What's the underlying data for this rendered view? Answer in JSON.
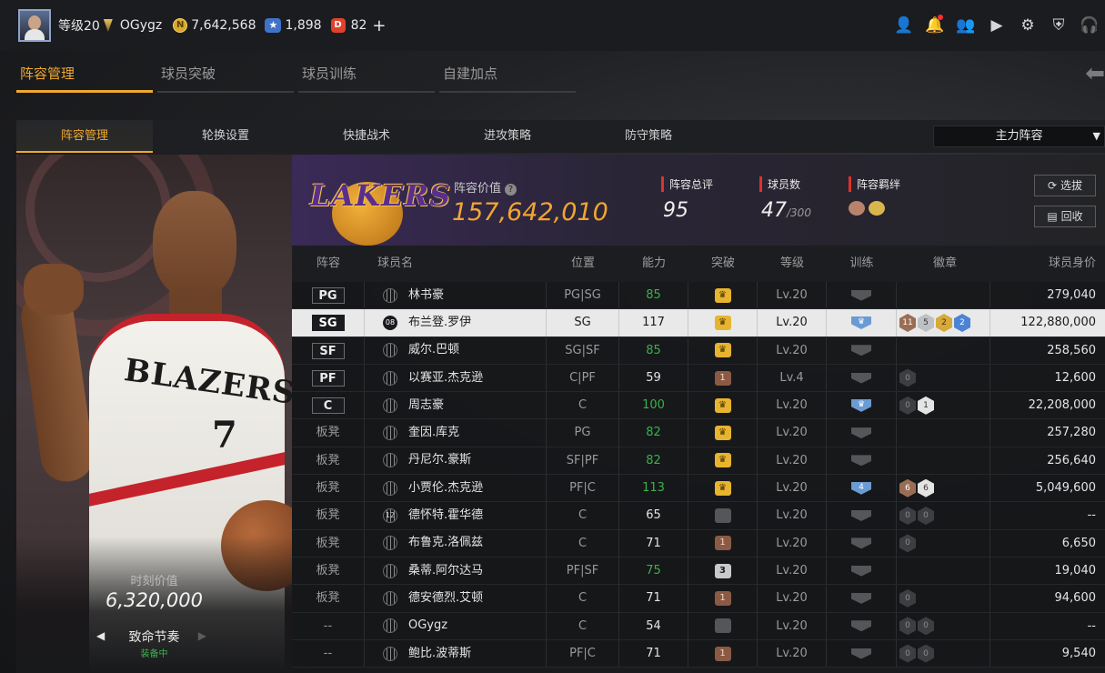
{
  "topbar": {
    "level": "等级20",
    "username": "OGygz",
    "coins": "7,642,568",
    "coin_icon": "N",
    "stars": "1,898",
    "star_icon": "★",
    "diamonds": "82",
    "diamond_icon": "D",
    "plus": "+",
    "icons": [
      "profile-icon",
      "bell-icon",
      "friends-icon",
      "video-icon",
      "gear-icon",
      "shield-icon",
      "headset-icon"
    ]
  },
  "main_tabs": [
    "阵容管理",
    "球员突破",
    "球员训练",
    "自建加点"
  ],
  "sub_tabs": [
    "阵容管理",
    "轮换设置",
    "快捷战术",
    "进攻策略",
    "防守策略"
  ],
  "lineup_select": "主力阵容",
  "player_card": {
    "jersey_text": "BLAZERS",
    "jersey_number": "7",
    "value_label": "时刻价值",
    "value": "6,320,000",
    "skill_name": "致命节奏",
    "skill_state": "装备中"
  },
  "team": {
    "logo_text": "LAKERS",
    "value_label": "阵容价值",
    "value": "157,642,010",
    "rating_label": "阵容总评",
    "rating": "95",
    "players_label": "球员数",
    "players_count": "47",
    "players_max": "/300",
    "bond_label": "阵容羁绊",
    "btn_select": "选拔",
    "btn_recycle": "回收"
  },
  "table": {
    "headers": [
      "阵容",
      "球员名",
      "位置",
      "能力",
      "突破",
      "等级",
      "训练",
      "徽章",
      "球员身价"
    ],
    "rows": [
      {
        "slot": "PG",
        "num": "",
        "name": "林书豪",
        "pos": "PG|SG",
        "ability": "85",
        "value": "279,040"
      },
      {
        "slot": "SG",
        "num": "08",
        "name": "布兰登.罗伊",
        "pos": "SG",
        "ability": "117",
        "value": "122,880,000"
      },
      {
        "slot": "SF",
        "num": "",
        "name": "威尔.巴顿",
        "pos": "SG|SF",
        "ability": "85",
        "value": "258,560"
      },
      {
        "slot": "PF",
        "num": "",
        "name": "以赛亚.杰克逊",
        "pos": "C|PF",
        "ability": "59",
        "value": "12,600"
      },
      {
        "slot": "C",
        "num": "",
        "name": "周志豪",
        "pos": "C",
        "ability": "100",
        "value": "22,208,000"
      },
      {
        "slot": "板凳",
        "num": "",
        "name": "奎因.库克",
        "pos": "PG",
        "ability": "82",
        "value": "257,280"
      },
      {
        "slot": "板凳",
        "num": "",
        "name": "丹尼尔.豪斯",
        "pos": "SF|PF",
        "ability": "82",
        "value": "256,640"
      },
      {
        "slot": "板凳",
        "num": "",
        "name": "小贾伦.杰克逊",
        "pos": "PF|C",
        "ability": "113",
        "value": "5,049,600"
      },
      {
        "slot": "板凳",
        "num": "12",
        "name": "德怀特.霍华德",
        "pos": "C",
        "ability": "65",
        "value": "--"
      },
      {
        "slot": "板凳",
        "num": "",
        "name": "布鲁克.洛佩兹",
        "pos": "C",
        "ability": "71",
        "value": "6,650"
      },
      {
        "slot": "板凳",
        "num": "",
        "name": "桑蒂.阿尔达马",
        "pos": "PF|SF",
        "ability": "75",
        "value": "19,040"
      },
      {
        "slot": "板凳",
        "num": "",
        "name": "德安德烈.艾顿",
        "pos": "C",
        "ability": "71",
        "value": "94,600"
      },
      {
        "slot": "--",
        "num": "",
        "name": "OGygz",
        "pos": "C",
        "ability": "54",
        "value": "--"
      },
      {
        "slot": "--",
        "num": "",
        "name": "鲍比.波蒂斯",
        "pos": "PF|C",
        "ability": "71",
        "value": "9,540"
      }
    ],
    "level_values": [
      "Lv.20",
      "Lv.20",
      "Lv.20",
      "Lv.4",
      "Lv.20",
      "Lv.20",
      "Lv.20",
      "Lv.20",
      "Lv.20",
      "Lv.20",
      "Lv.20",
      "Lv.20",
      "Lv.20",
      "Lv.20"
    ],
    "badge_numbers": {
      "sg": [
        "11",
        "5",
        "2",
        "2"
      ],
      "c": [
        "0",
        "1"
      ],
      "bench3": [
        "6",
        "6"
      ],
      "bench4": [
        "0",
        "0"
      ],
      "bench5": [
        "0"
      ],
      "bench7": [
        "0"
      ],
      "self": [
        "0",
        "0"
      ],
      "last": [
        "0",
        "0"
      ]
    },
    "breakthrough_numbers": {
      "bench6": "3"
    },
    "training_numbers": {
      "bench3": "4"
    }
  },
  "colors": {
    "accent": "#f0a830",
    "team_value": "#f2a531",
    "ability_green": "#38b24a",
    "stat_red": "#e0312a"
  }
}
